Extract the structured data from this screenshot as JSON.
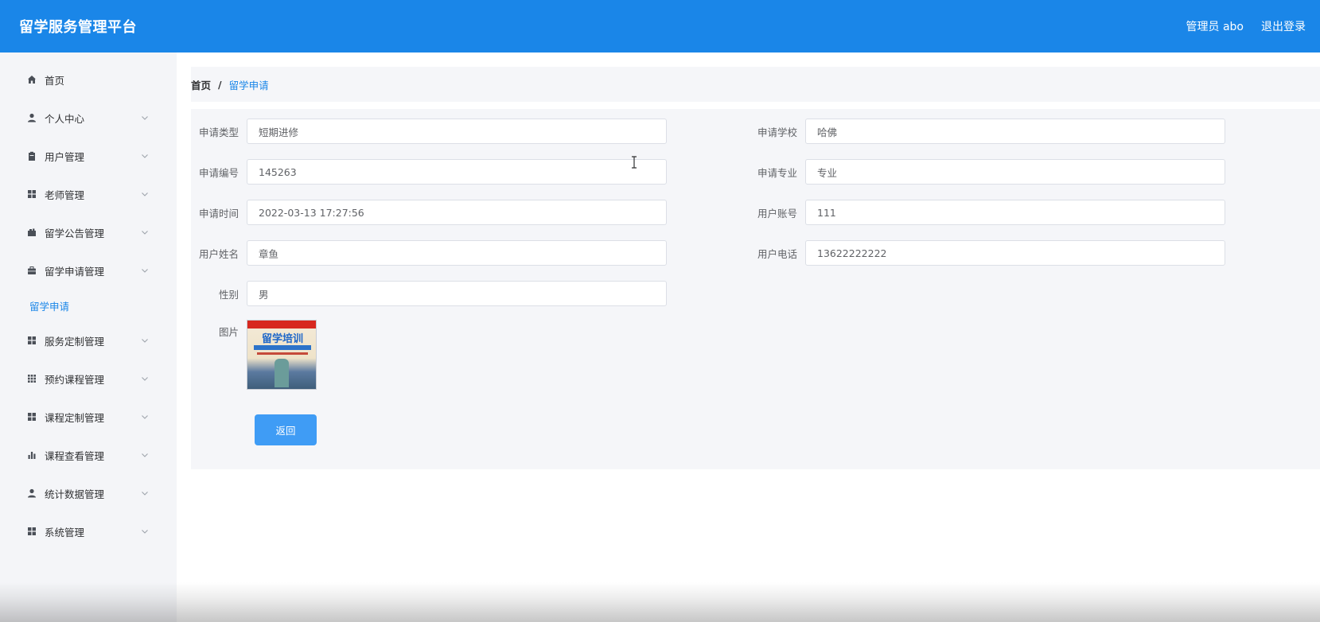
{
  "header": {
    "app_title": "留学服务管理平台",
    "user_label": "管理员 abo",
    "logout_label": "退出登录"
  },
  "sidebar": {
    "items": [
      {
        "label": "首页",
        "icon": "home-icon",
        "has_children": false
      },
      {
        "label": "个人中心",
        "icon": "user-icon",
        "has_children": true
      },
      {
        "label": "用户管理",
        "icon": "clipboard-icon",
        "has_children": true
      },
      {
        "label": "老师管理",
        "icon": "grid-icon",
        "has_children": true
      },
      {
        "label": "留学公告管理",
        "icon": "briefcase-icon",
        "has_children": true
      },
      {
        "label": "留学申请管理",
        "icon": "suitcase-icon",
        "has_children": true,
        "expanded": true,
        "children": [
          "留学申请"
        ]
      },
      {
        "label": "服务定制管理",
        "icon": "grid-icon",
        "has_children": true
      },
      {
        "label": "预约课程管理",
        "icon": "dots-grid-icon",
        "has_children": true
      },
      {
        "label": "课程定制管理",
        "icon": "grid-icon",
        "has_children": true
      },
      {
        "label": "课程查看管理",
        "icon": "bar-chart-icon",
        "has_children": true
      },
      {
        "label": "统计数据管理",
        "icon": "user-icon",
        "has_children": true
      },
      {
        "label": "系统管理",
        "icon": "grid-icon",
        "has_children": true
      }
    ]
  },
  "breadcrumb": {
    "home": "首页",
    "separator": "/",
    "current": "留学申请"
  },
  "form": {
    "application_type": {
      "label": "申请类型",
      "value": "短期进修"
    },
    "application_school": {
      "label": "申请学校",
      "value": "哈佛"
    },
    "application_number": {
      "label": "申请编号",
      "value": "145263"
    },
    "application_major": {
      "label": "申请专业",
      "value": "专业"
    },
    "application_time": {
      "label": "申请时间",
      "value": "2022-03-13 17:27:56"
    },
    "user_account": {
      "label": "用户账号",
      "value": "111"
    },
    "user_name": {
      "label": "用户姓名",
      "value": "章鱼"
    },
    "user_phone": {
      "label": "用户电话",
      "value": "13622222222"
    },
    "gender": {
      "label": "性别",
      "value": "男"
    },
    "picture": {
      "label": "图片",
      "image_text": "留学培训"
    },
    "back_label": "返回"
  },
  "colors": {
    "header_bg": "#1a86e8",
    "accent": "#1a86e8",
    "button_bg": "#3f9cf5",
    "sidebar_bg": "#f4f5f8",
    "panel_bg": "#f5f6f9"
  }
}
